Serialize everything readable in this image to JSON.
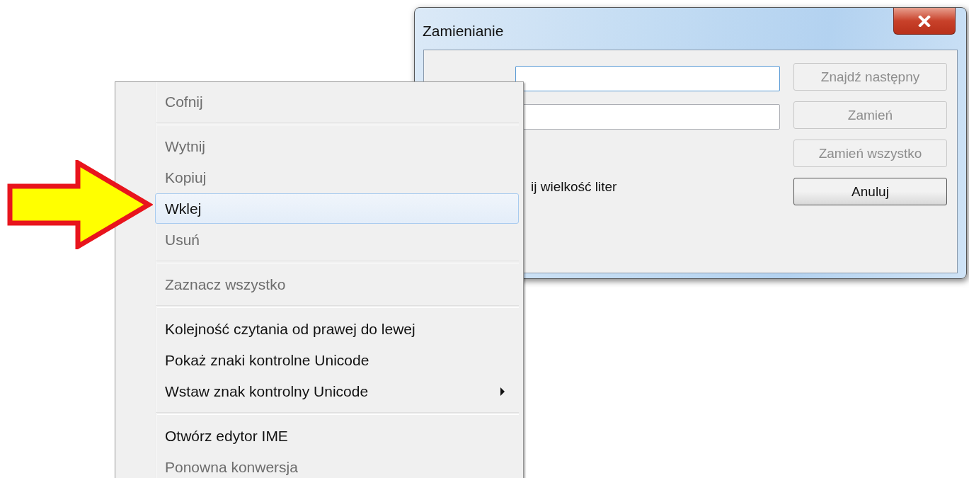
{
  "dialog": {
    "title": "Zamienianie",
    "find_field": {
      "focused": true
    },
    "replace_field": {
      "focused": false
    },
    "checkbox_label": "ij wielkość liter",
    "buttons": [
      {
        "label": "Znajdź następny",
        "disabled": true,
        "default": false
      },
      {
        "label": "Zamień",
        "disabled": true,
        "default": false
      },
      {
        "label": "Zamień wszystko",
        "disabled": true,
        "default": false
      },
      {
        "label": "Anuluj",
        "disabled": false,
        "default": true
      }
    ]
  },
  "context_menu": {
    "items": [
      {
        "kind": "item",
        "label": "Cofnij",
        "disabled": true,
        "selected": false,
        "submenu": false
      },
      {
        "kind": "separator"
      },
      {
        "kind": "item",
        "label": "Wytnij",
        "disabled": true,
        "selected": false,
        "submenu": false
      },
      {
        "kind": "item",
        "label": "Kopiuj",
        "disabled": true,
        "selected": false,
        "submenu": false
      },
      {
        "kind": "item",
        "label": "Wklej",
        "disabled": false,
        "selected": true,
        "submenu": false
      },
      {
        "kind": "item",
        "label": "Usuń",
        "disabled": true,
        "selected": false,
        "submenu": false
      },
      {
        "kind": "separator"
      },
      {
        "kind": "item",
        "label": "Zaznacz wszystko",
        "disabled": true,
        "selected": false,
        "submenu": false
      },
      {
        "kind": "separator"
      },
      {
        "kind": "item",
        "label": "Kolejność czytania od prawej do lewej",
        "disabled": false,
        "selected": false,
        "submenu": false
      },
      {
        "kind": "item",
        "label": "Pokaż znaki kontrolne Unicode",
        "disabled": false,
        "selected": false,
        "submenu": false
      },
      {
        "kind": "item",
        "label": "Wstaw znak kontrolny Unicode",
        "disabled": false,
        "selected": false,
        "submenu": true
      },
      {
        "kind": "separator"
      },
      {
        "kind": "item",
        "label": "Otwórz edytor IME",
        "disabled": false,
        "selected": false,
        "submenu": false
      },
      {
        "kind": "item",
        "label": "Ponowna konwersja",
        "disabled": true,
        "selected": false,
        "submenu": false
      }
    ]
  }
}
